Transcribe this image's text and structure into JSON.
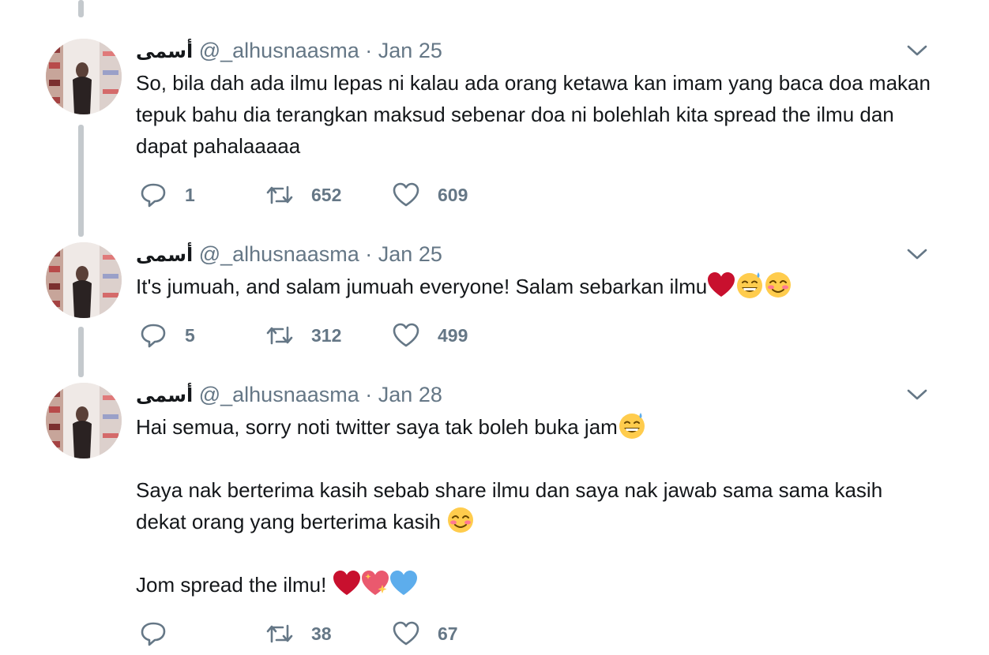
{
  "tweets": [
    {
      "name": "أسمى",
      "handle": "@_alhusnaasma",
      "separator": "·",
      "date": "Jan 25",
      "paragraphs": [
        "So, bila dah ada ilmu lepas ni kalau ada orang ketawa kan imam yang baca doa makan tepuk bahu dia terangkan maksud sebenar doa ni bolehlah kita spread the ilmu dan dapat pahalaaaaa"
      ],
      "replies": "1",
      "retweets": "652",
      "likes": "609"
    },
    {
      "name": "أسمى",
      "handle": "@_alhusnaasma",
      "separator": "·",
      "date": "Jan 25",
      "paragraphs": [
        "It's jumuah, and salam jumuah everyone! Salam sebarkan ilmu"
      ],
      "emojis": [
        "red-heart-emoji",
        "sweat-smile-emoji",
        "blush-emoji"
      ],
      "replies": "5",
      "retweets": "312",
      "likes": "499"
    },
    {
      "name": "أسمى",
      "handle": "@_alhusnaasma",
      "separator": "·",
      "date": "Jan 28",
      "paragraphs": [
        "Hai semua, sorry noti twitter saya tak boleh buka jam",
        "Saya nak berterima kasih sebab share ilmu dan saya nak jawab sama sama kasih dekat orang yang berterima kasih ",
        "Jom spread the ilmu! "
      ],
      "replies": "",
      "retweets": "38",
      "likes": "67"
    }
  ],
  "icons": {
    "reply": "reply-icon",
    "retweet": "retweet-icon",
    "like": "heart-icon",
    "caret": "chevron-down-icon"
  },
  "colors": {
    "text": "#14171a",
    "muted": "#657786",
    "thread_line": "#c4c9cd",
    "heart_red": "#c8102e",
    "heart_blue": "#5dadec",
    "emoji_yellow": "#ffcc4d"
  }
}
